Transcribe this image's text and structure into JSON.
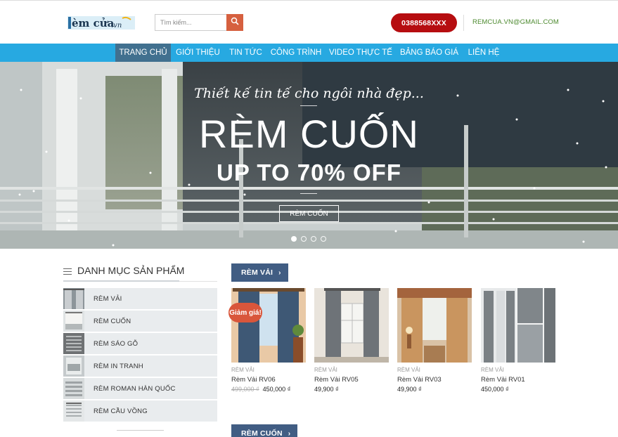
{
  "header": {
    "logo_text": "èm cửa.vn",
    "search_placeholder": "Tìm kiếm...",
    "phone": "0388568XXX",
    "email": "REMCUA.VN@GMAIL.COM"
  },
  "nav": {
    "items": [
      "TRANG CHỦ",
      "GIỚI THIỆU",
      "TIN TỨC",
      "CÔNG TRÌNH",
      "VIDEO THỰC TẾ",
      "BẢNG BÁO GIÁ",
      "LIÊN HỆ"
    ],
    "active_index": 0
  },
  "banner": {
    "tagline": "Thiết kế tin tế cho ngôi nhà đẹp...",
    "title": "RÈM CUỐN",
    "subtitle": "UP TO 70% OFF",
    "cta": "RÈM CUỐN",
    "slide_count": 4,
    "active_slide": 1
  },
  "sidebar": {
    "title": "DANH MỤC SẢN PHẨM",
    "categories": [
      "RÈM VẢI",
      "RÈM CUỐN",
      "RÈM SÁO GỖ",
      "RÈM IN TRANH",
      "RÈM ROMAN HÀN QUỐC",
      "RÈM CẦU VỒNG"
    ]
  },
  "sections": [
    {
      "button": "RÈM VẢI",
      "products": [
        {
          "category": "RÈM VẢI",
          "name": "Rèm Vải RV06",
          "old_price": "499,000 ₫",
          "price": "450,000 ₫",
          "badge": "Giảm giá!"
        },
        {
          "category": "RÈM VẢI",
          "name": "Rèm Vải RV05",
          "price": "49,900 ₫"
        },
        {
          "category": "RÈM VẢI",
          "name": "Rèm Vải RV03",
          "price": "49,900 ₫"
        },
        {
          "category": "RÈM VẢI",
          "name": "Rèm Vải RV01",
          "price": "450,000 ₫"
        }
      ]
    },
    {
      "button": "RÈM CUỐN",
      "products": []
    }
  ],
  "colors": {
    "nav_bg": "#27a9e1",
    "nav_active": "#41708f",
    "phone_bg": "#b60d10",
    "email": "#4d8a2f",
    "section_button": "#415d83",
    "sale_badge": "#d9563b",
    "search_button": "#d6603f"
  }
}
